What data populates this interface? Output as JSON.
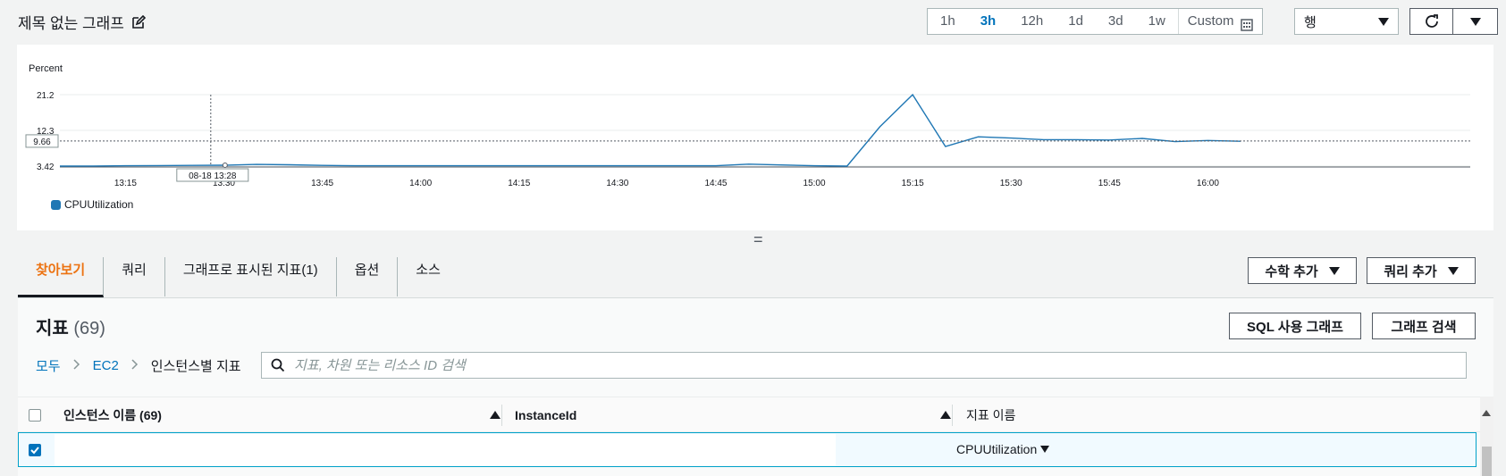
{
  "header": {
    "title": "제목 없는 그래프",
    "ranges": [
      "1h",
      "3h",
      "12h",
      "1d",
      "3d",
      "1w"
    ],
    "active_range": "3h",
    "custom_label": "Custom",
    "row_select_value": "행"
  },
  "chart_data": {
    "type": "line",
    "ylabel": "Percent",
    "y_ticks": [
      3.42,
      12.3,
      21.2
    ],
    "ylim": [
      3.42,
      21.2
    ],
    "x_ticks": [
      "13:15",
      "13:30",
      "13:45",
      "14:00",
      "14:15",
      "14:30",
      "14:45",
      "15:00",
      "15:15",
      "15:30",
      "15:45",
      "16:00"
    ],
    "series": [
      {
        "name": "CPUUtilization",
        "color": "#1f77b4",
        "x": [
          "13:05",
          "13:10",
          "13:15",
          "13:20",
          "13:25",
          "13:30",
          "13:35",
          "13:40",
          "13:45",
          "13:50",
          "13:55",
          "14:00",
          "14:05",
          "14:10",
          "14:15",
          "14:20",
          "14:25",
          "14:30",
          "14:35",
          "14:40",
          "14:45",
          "14:50",
          "14:55",
          "15:00",
          "15:05",
          "15:10",
          "15:15",
          "15:20",
          "15:25",
          "15:30",
          "15:35",
          "15:40",
          "15:45",
          "15:50",
          "15:55",
          "16:00",
          "16:05"
        ],
        "values": [
          3.42,
          3.45,
          3.5,
          3.55,
          3.6,
          3.65,
          3.85,
          3.75,
          3.6,
          3.5,
          3.5,
          3.5,
          3.5,
          3.5,
          3.5,
          3.5,
          3.5,
          3.5,
          3.5,
          3.5,
          3.5,
          3.9,
          3.7,
          3.5,
          3.42,
          13.2,
          21.2,
          8.3,
          10.7,
          10.4,
          10.0,
          10.0,
          9.9,
          10.3,
          9.5,
          9.8,
          9.6
        ]
      }
    ],
    "crosshair": {
      "x_label": "08-18 13:28",
      "y_label": "9.66"
    },
    "grid": true,
    "legend": "bottom-left"
  },
  "splitter_glyph": "=",
  "tabs": [
    "찾아보기",
    "쿼리",
    "그래프로 표시된 지표(1)",
    "옵션",
    "소스"
  ],
  "actions": {
    "math": "수학 추가",
    "query": "쿼리 추가",
    "sql": "SQL 사용 그래프",
    "search_graph": "그래프 검색"
  },
  "metrics": {
    "title": "지표",
    "count": "(69)",
    "breadcrumb": [
      "모두",
      "EC2",
      "인스턴스별 지표"
    ],
    "search_placeholder": "지표, 차원 또는 리소스 ID 검색"
  },
  "table": {
    "columns": [
      "인스턴스 이름 (69)",
      "InstanceId",
      "지표 이름"
    ],
    "rows": [
      {
        "metric_name": "CPUUtilization",
        "checked": true
      }
    ]
  }
}
